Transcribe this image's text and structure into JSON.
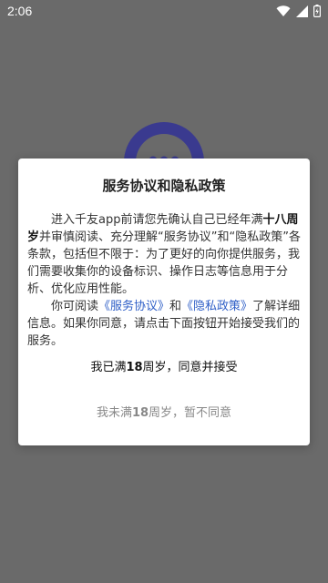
{
  "status_bar": {
    "time": "2:06",
    "icons": [
      "wifi-icon",
      "cellular-signal-icon",
      "battery-icon"
    ]
  },
  "colors": {
    "overlay_background": "#6a6a6a",
    "logo_ring": "#3a3a8f",
    "link": "#2f5fc7",
    "decline_text": "#888888"
  },
  "dialog": {
    "title": "服务协议和隐私政策",
    "para1": {
      "t1": "进入千友app前请您先确认自己已经年满",
      "bold": "十八周岁",
      "t2": "并审慎阅读、充分理解“服务协议”和“隐私政策”各条款，包括但不限于：为了更好的向你提供服务，我们需要收集你的设备标识、操作日志等信息用于分析、优化应用性能。"
    },
    "para2": {
      "t1": "你可阅读",
      "link_service": "《服务协议》",
      "t2": "和",
      "link_privacy": "《隐私政策》",
      "t3": "了解详细信息。如果你同意，请点击下面按钮开始接受我们的服务。"
    },
    "accept": {
      "t1": "我已满",
      "num": "18",
      "t2": "周岁，同意并接受"
    },
    "decline": {
      "t1": "我未满",
      "num": "18",
      "t2": "周岁，暂不同意"
    }
  }
}
